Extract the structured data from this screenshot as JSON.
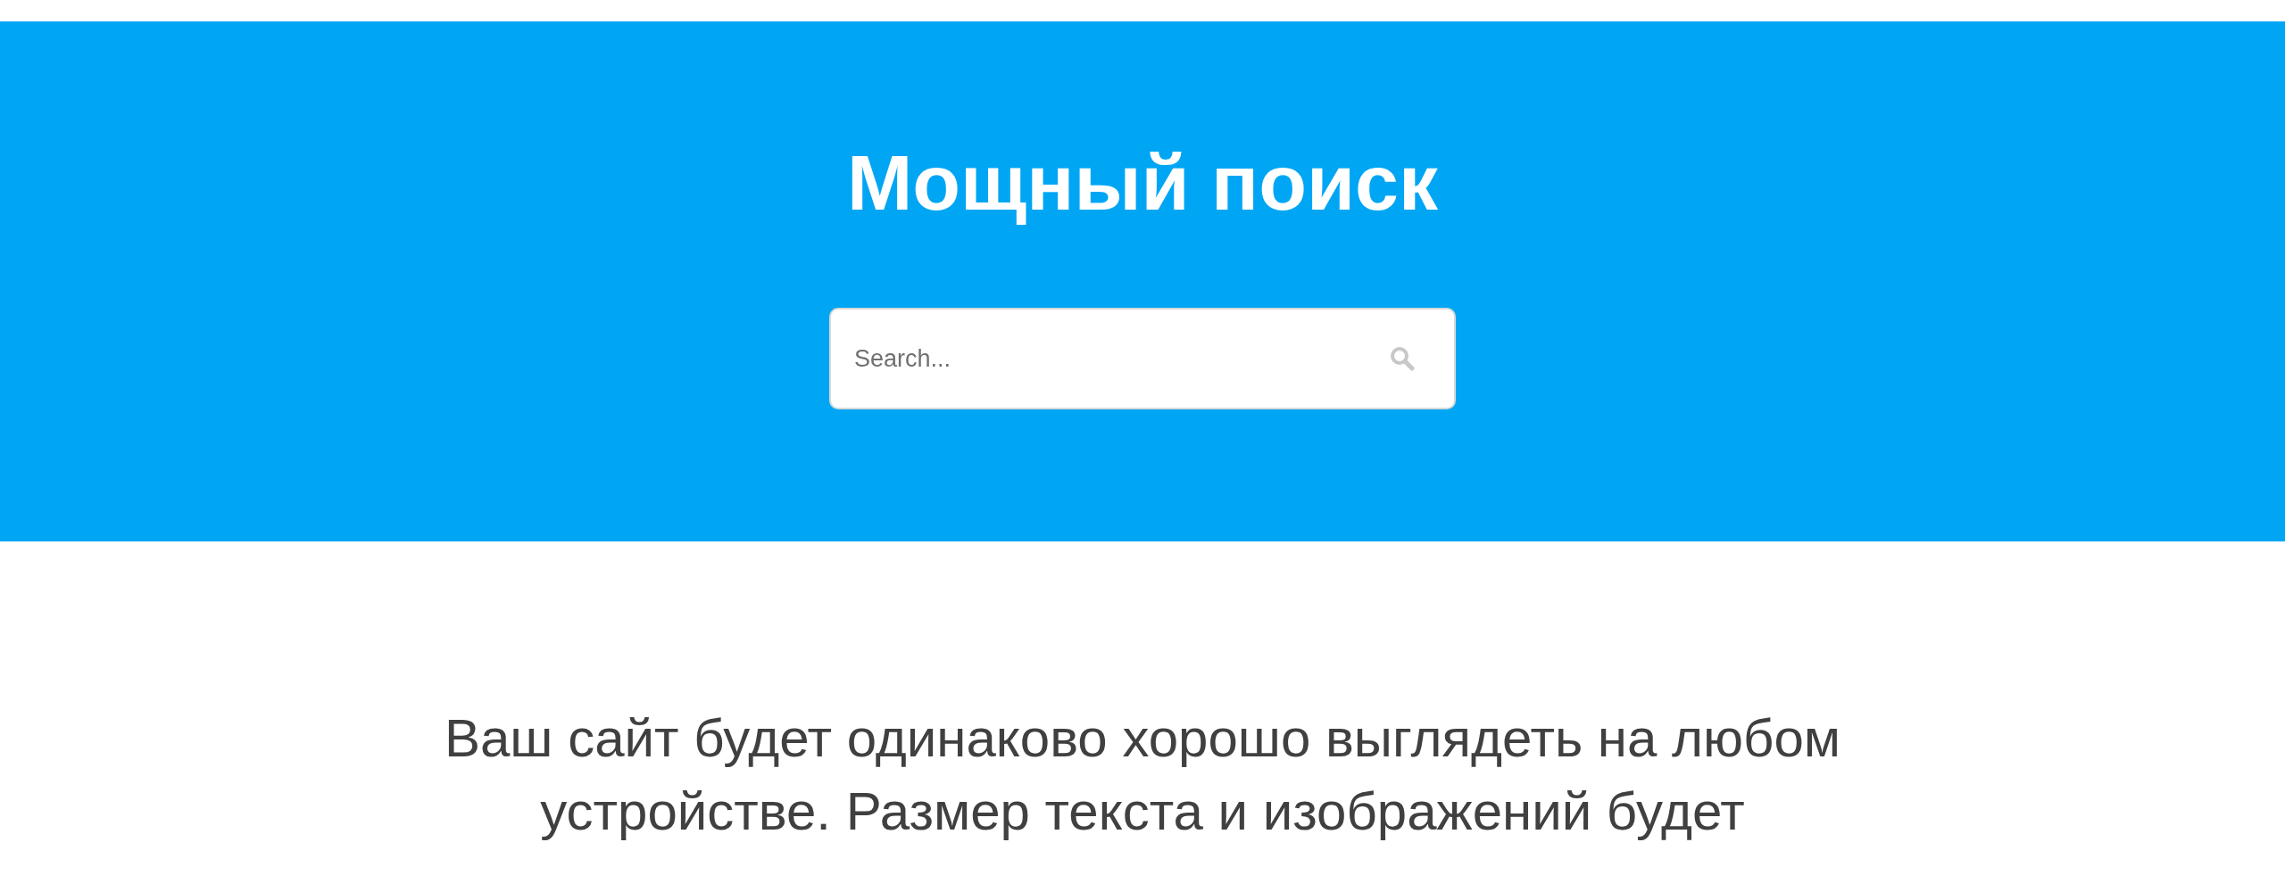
{
  "hero": {
    "title": "Мощный поиск",
    "search": {
      "placeholder": "Search..."
    }
  },
  "intro": {
    "text": "Ваш сайт будет одинаково хорошо выглядеть на любом устройстве. Размер текста и изображений будет"
  }
}
